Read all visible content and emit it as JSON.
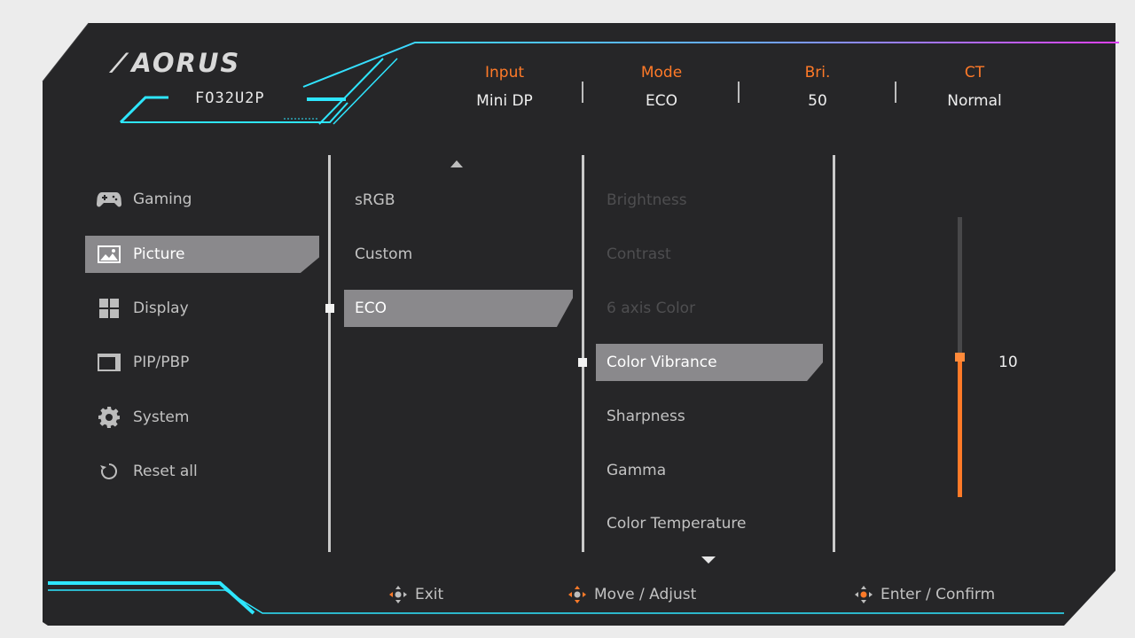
{
  "header": {
    "brand": "AORUS",
    "model": "FO32U2P",
    "status": [
      {
        "label": "Input",
        "value": "Mini DP"
      },
      {
        "label": "Mode",
        "value": "ECO"
      },
      {
        "label": "Bri.",
        "value": "50"
      },
      {
        "label": "CT",
        "value": "Normal"
      }
    ]
  },
  "main_menu": [
    {
      "label": "Gaming",
      "icon": "gamepad-icon"
    },
    {
      "label": "Picture",
      "icon": "picture-icon",
      "selected": true
    },
    {
      "label": "Display",
      "icon": "display-grid-icon"
    },
    {
      "label": "PIP/PBP",
      "icon": "pip-icon"
    },
    {
      "label": "System",
      "icon": "gear-icon"
    },
    {
      "label": "Reset all",
      "icon": "reset-icon"
    }
  ],
  "picture_modes": [
    {
      "label": "sRGB"
    },
    {
      "label": "Custom"
    },
    {
      "label": "ECO",
      "selected": true
    }
  ],
  "settings": [
    {
      "label": "Brightness",
      "disabled": true
    },
    {
      "label": "Contrast",
      "disabled": true
    },
    {
      "label": "6 axis Color",
      "disabled": true
    },
    {
      "label": "Color Vibrance",
      "selected": true
    },
    {
      "label": "Sharpness"
    },
    {
      "label": "Gamma"
    },
    {
      "label": "Color Temperature"
    }
  ],
  "slider": {
    "value": "10",
    "level_fraction": 0.5
  },
  "footer": {
    "exit": "Exit",
    "move": "Move / Adjust",
    "enter": "Enter / Confirm"
  },
  "colors": {
    "accent_orange": "#ff7a28",
    "accent_cyan": "#2ee6ff",
    "accent_magenta": "#e040ff",
    "panel": "#262628",
    "selected_bg": "#8a898c"
  }
}
